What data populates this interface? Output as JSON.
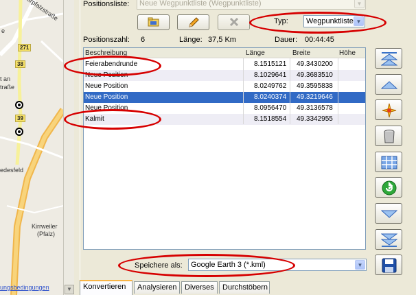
{
  "map": {
    "street1": "Kurpfalzstraße",
    "street2_a": "t an",
    "street2_b": "traße",
    "letter_d": "e",
    "village1": "edesfeld",
    "village2_a": "Kirrweiler",
    "village2_b": "(Pfalz)",
    "roads": [
      "271",
      "38",
      "39"
    ],
    "footer_link": "ungsbedingungen"
  },
  "positionsliste": {
    "label": "Positionsliste:",
    "value": "Neue Wegpunktliste (Wegpunktliste)"
  },
  "typ": {
    "label": "Typ:",
    "value": "Wegpunktliste"
  },
  "summary": {
    "count_label": "Positionszahl:",
    "count": "6",
    "length_label": "Länge:",
    "length": "37,5 Km",
    "duration_label": "Dauer:",
    "duration": "00:44:45"
  },
  "table": {
    "headers": [
      "Beschreibung",
      "Länge",
      "Breite",
      "Höhe"
    ],
    "rows": [
      {
        "desc": "Feierabendrunde",
        "lon": "8.1515121",
        "lat": "49.3430200",
        "alt": ""
      },
      {
        "desc": "Neue Position",
        "lon": "8.1029641",
        "lat": "49.3683510",
        "alt": ""
      },
      {
        "desc": "Neue Position",
        "lon": "8.0249762",
        "lat": "49.3595838",
        "alt": ""
      },
      {
        "desc": "Neue Position",
        "lon": "8.0240374",
        "lat": "49.3219646",
        "alt": ""
      },
      {
        "desc": "Neue Position",
        "lon": "8.0956470",
        "lat": "49.3136578",
        "alt": ""
      },
      {
        "desc": "Kalmit",
        "lon": "8.1518554",
        "lat": "49.3342955",
        "alt": ""
      }
    ],
    "selected_index": 3
  },
  "save": {
    "label": "Speichere als:",
    "value": "Google Earth 3 (*.kml)"
  },
  "tabs": [
    "Konvertieren",
    "Analysieren",
    "Diverses",
    "Durchstöbern"
  ],
  "colors": {
    "highlight": "#d60000",
    "selection": "#316ac5",
    "panel": "#ece9d8"
  }
}
